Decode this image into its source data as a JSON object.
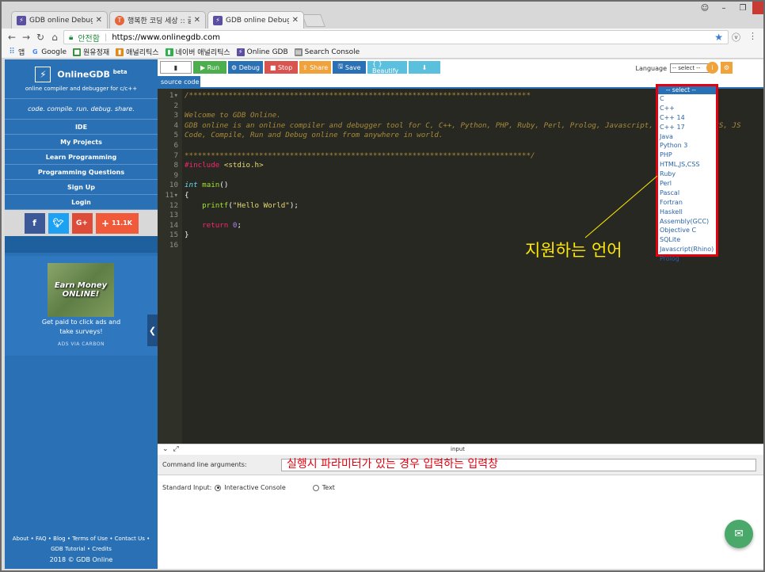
{
  "browser": {
    "tabs": [
      {
        "title": "GDB online Debugger |",
        "icon": "bolt-icon"
      },
      {
        "title": "행복한 코딩 세상 :: 글쓰",
        "icon": "t-icon"
      },
      {
        "title": "GDB online Debugger |",
        "icon": "bolt-icon"
      }
    ],
    "secure_label": "안전함",
    "url": "https://www.onlinegdb.com",
    "bookmarks": [
      "앱",
      "Google",
      "원유정재",
      "애널리틱스",
      "네이버 애널리틱스",
      "Online GDB",
      "Search Console"
    ]
  },
  "sidebar": {
    "brand": "OnlineGDB",
    "brand_sup": "beta",
    "brand_sub": "online compiler and debugger for c/c++",
    "tagline": "code. compile. run. debug. share.",
    "nav": [
      "IDE",
      "My Projects",
      "Learn Programming",
      "Programming Questions",
      "Sign Up",
      "Login"
    ],
    "share_count": "11.1K",
    "ad": {
      "image_line1": "Earn Money",
      "image_line2": "ONLINE!",
      "text1": "Get paid to click ads and",
      "text2": "take surveys!",
      "via": "ADS VIA CARBON"
    },
    "footer": {
      "line1": "About • FAQ • Blog • Terms of Use • Contact Us •",
      "line2": "GDB Tutorial • Credits",
      "copyright": "2018 © GDB Online"
    }
  },
  "toolbar": {
    "run": "Run",
    "debug": "Debug",
    "stop": "Stop",
    "share": "Share",
    "save": "Save",
    "beautify": "{ } Beautify",
    "language_label": "Language",
    "language_value": "-- select --"
  },
  "editor": {
    "tab": "source code",
    "lines": [
      "/******************************************************************************",
      "",
      "Welcome to GDB Online.",
      "GDB online is an online compiler and debugger tool for C, C++, Python, PHP, Ruby, Perl, Prolog, Javascript, Java, HTML, CSS, JS",
      "Code, Compile, Run and Debug online from anywhere in world.",
      "",
      "*******************************************************************************/",
      "#include <stdio.h>",
      "",
      "int main()",
      "{",
      "    printf(\"Hello World\");",
      "",
      "    return 0;",
      "}",
      ""
    ]
  },
  "dropdown": {
    "header": "-- select --",
    "options": [
      "C",
      "C++",
      "C++ 14",
      "C++ 17",
      "Java",
      "Python 3",
      "PHP",
      "HTML,JS,CSS",
      "Ruby",
      "Perl",
      "Pascal",
      "Fortran",
      "Haskell",
      "Assembly(GCC)",
      "Objective C",
      "SQLite",
      "Javascript(Rhino)",
      "Prolog"
    ]
  },
  "annotations": {
    "languages": "지원하는 언어",
    "input_box": "실행시 파라미터가 있는 경우 입력하는 입력창"
  },
  "input_panel": {
    "title": "input",
    "cla_label": "Command line arguments:",
    "stdin_label": "Standard Input:",
    "opt_interactive": "Interactive Console",
    "opt_text": "Text"
  },
  "colors": {
    "brand_blue": "#2a70b5",
    "run_green": "#4cae4c",
    "stop_red": "#d9534f",
    "share_orange": "#f0a23c",
    "highlight_red": "#e3000f",
    "annotation_yellow": "#ffe900"
  }
}
